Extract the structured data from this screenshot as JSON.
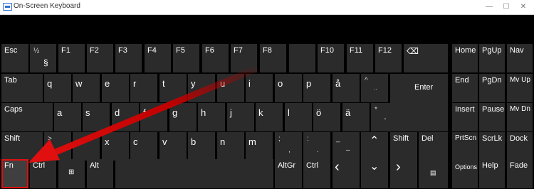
{
  "window": {
    "title": "On-Screen Keyboard",
    "minimize": "—",
    "maximize": "☐",
    "close": "✕"
  },
  "colors": {
    "key": "#2b2b2b",
    "background": "#000000",
    "highlight": "#e01010",
    "fn_key": "#3f3f3f"
  },
  "keys": {
    "esc": "Esc",
    "half": "½",
    "section": "§",
    "f1": "F1",
    "f2": "F2",
    "f3": "F3",
    "f4": "F4",
    "f5": "F5",
    "f6": "F6",
    "f7": "F7",
    "f8": "F8",
    "f10": "F10",
    "f11": "F11",
    "f12": "F12",
    "backspace": "⌫",
    "home": "Home",
    "pgup": "PgUp",
    "nav": "Nav",
    "tab": "Tab",
    "q": "q",
    "w": "w",
    "e": "e",
    "r": "r",
    "t": "t",
    "y": "y",
    "u": "u",
    "i": "i",
    "o": "o",
    "p": "p",
    "aring": "å",
    "caret": "^",
    "diaeresis": "¨",
    "enter": "Enter",
    "end": "End",
    "pgdn": "PgDn",
    "mvup": "Mv Up",
    "caps": "Caps",
    "a": "a",
    "s": "s",
    "d": "d",
    "f": "f",
    "g": "g",
    "h": "h",
    "j": "j",
    "k": "k",
    "l": "l",
    "ouml": "ö",
    "auml": "ä",
    "asterisk": "*",
    "apostrophe": "'",
    "insert": "Insert",
    "pause": "Pause",
    "mvdn": "Mv Dn",
    "shift": "Shift",
    "gt": ">",
    "z": "z",
    "x": "x",
    "c": "c",
    "v": "v",
    "b": "b",
    "n": "n",
    "m": "m",
    "semicolon": ";",
    "comma": ",",
    "colon": ":",
    "period": ".",
    "underscore": "_",
    "dash": "–",
    "up": "⌃",
    "del": "Del",
    "prtscn": "PrtScn",
    "scrlk": "ScrLk",
    "dock": "Dock",
    "fn": "Fn",
    "ctrl": "Ctrl",
    "win": "⊞",
    "alt": "Alt",
    "altgr": "AltGr",
    "left": "‹",
    "down": "⌄",
    "right": "›",
    "menu": "▤",
    "options": "Options",
    "help": "Help",
    "fade": "Fade"
  }
}
